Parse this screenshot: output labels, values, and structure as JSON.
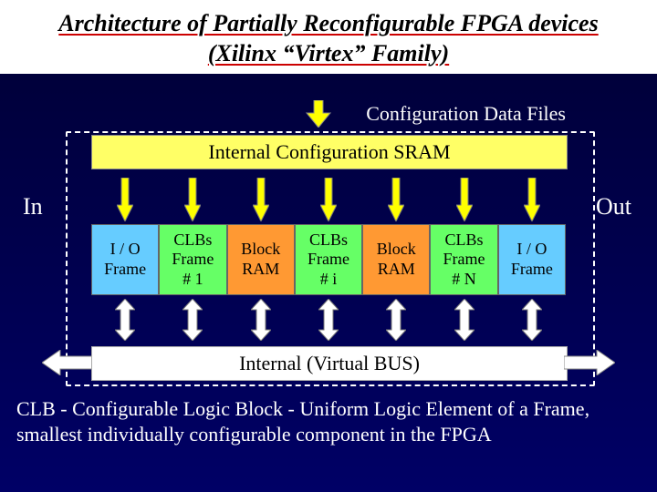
{
  "title": "Architecture of Partially Reconfigurable FPGA devices (Xilinx “Virtex” Family)",
  "cfg_label": "Configuration Data Files",
  "sram_label": "Internal Configuration SRAM",
  "in_label": "In",
  "out_label": "Out",
  "bus_label": "Internal (Virtual BUS)",
  "frames": [
    {
      "l1": "I / O",
      "l2": "Frame",
      "l3": "",
      "color": "c-blue"
    },
    {
      "l1": "CLBs",
      "l2": "Frame",
      "l3": "# 1",
      "color": "c-green"
    },
    {
      "l1": "Block",
      "l2": "RAM",
      "l3": "",
      "color": "c-orange"
    },
    {
      "l1": "CLBs",
      "l2": "Frame",
      "l3": "# i",
      "color": "c-green"
    },
    {
      "l1": "Block",
      "l2": "RAM",
      "l3": "",
      "color": "c-orange"
    },
    {
      "l1": "CLBs",
      "l2": "Frame",
      "l3": "# N",
      "color": "c-green"
    },
    {
      "l1": "I / O",
      "l2": "Frame",
      "l3": "",
      "color": "c-blue"
    }
  ],
  "footer": "CLB - Configurable Logic Block - Uniform Logic Element of a Frame, smallest individually configurable component in the FPGA",
  "colors": {
    "arrow_yellow": "#ffff00",
    "arrow_white": "#ffffff"
  }
}
